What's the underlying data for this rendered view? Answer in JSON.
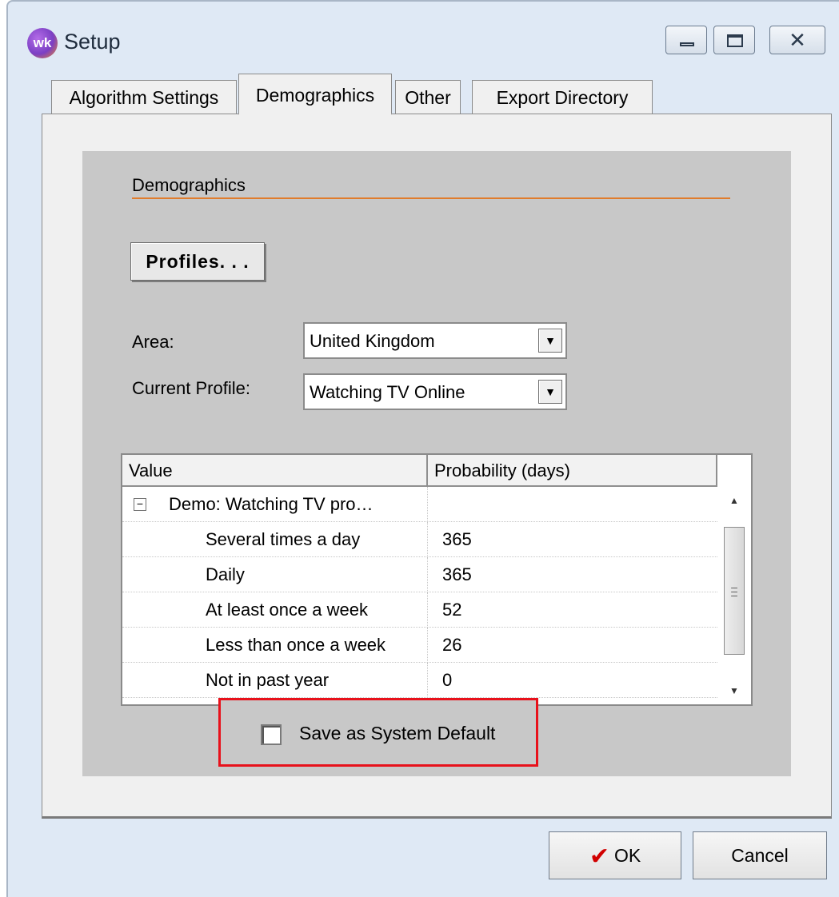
{
  "window": {
    "title": "Setup",
    "app_icon_text": "wk"
  },
  "tabs": [
    {
      "label": "Algorithm Settings",
      "selected": false
    },
    {
      "label": "Demographics",
      "selected": true
    },
    {
      "label": "Other",
      "selected": false
    },
    {
      "label": "Export Directory",
      "selected": false
    }
  ],
  "demographics": {
    "section_title": "Demographics",
    "profiles_button": "Profiles. . .",
    "area": {
      "label": "Area:",
      "value": "United Kingdom"
    },
    "current_profile": {
      "label": "Current Profile:",
      "value": "Watching TV Online"
    },
    "grid": {
      "columns": [
        "Value",
        "Probability (days)"
      ],
      "group": {
        "expander": "−",
        "label": "Demo: Watching TV pro…"
      },
      "rows": [
        {
          "value": "Several times a day",
          "probability": "365"
        },
        {
          "value": "Daily",
          "probability": "365"
        },
        {
          "value": "At least once a week",
          "probability": "52"
        },
        {
          "value": "Less than once a week",
          "probability": "26"
        },
        {
          "value": "Not in past year",
          "probability": "0"
        }
      ]
    },
    "save_default": {
      "label": "Save as System Default",
      "checked": false
    }
  },
  "buttons": {
    "ok": "OK",
    "cancel": "Cancel"
  },
  "colors": {
    "accent_rule": "#e07c2c",
    "highlight_border": "#e8111b",
    "ok_check": "#d10000"
  }
}
